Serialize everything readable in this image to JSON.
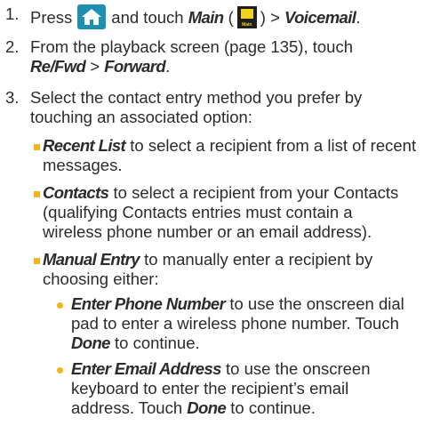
{
  "colors": {
    "text": "#2b2b2b",
    "bullet": "#f2b61c",
    "home_icon_bg": "#1d8fb0",
    "main_icon_bg": "#1e1e1e",
    "main_icon_accent": "#f2d21a"
  },
  "step1": {
    "number": "1.",
    "press": "Press",
    "and_touch": "and touch",
    "main": "Main",
    "paren_open": "(",
    "main_icon_label": "Main",
    "paren_close": ")",
    "sep": " > ",
    "voicemail": "Voicemail",
    "period": "."
  },
  "step2": {
    "number": "2.",
    "line1": "From the playback screen (page 135), touch",
    "re_fwd": "Re/Fwd",
    "sep": " > ",
    "forward": "Forward",
    "period": "."
  },
  "step3": {
    "number": "3.",
    "line1": "Select the contact entry method you prefer by",
    "line2": "touching an associated option:",
    "options": [
      {
        "name": "Recent List",
        "lines": [
          " to select a recipient from a list of recent",
          "messages."
        ]
      },
      {
        "name": "Contacts",
        "lines": [
          " to select a recipient from your Contacts",
          "(qualifying Contacts entries must contain a",
          "wireless phone number or an email address)."
        ]
      },
      {
        "name": "Manual Entry",
        "lines": [
          " to manually enter a recipient by",
          "choosing either:"
        ]
      }
    ],
    "sub_options": [
      {
        "name": "Enter Phone Number",
        "line1": " to use the onscreen dial",
        "line2": "pad to enter a wireless phone number. Touch",
        "done": "Done",
        "tail": " to continue."
      },
      {
        "name": "Enter Email Address",
        "line1": " to use the onscreen",
        "line2": "keyboard to enter the recipient’s email",
        "line3_pre": "address. Touch ",
        "done": "Done",
        "tail": " to continue."
      }
    ]
  },
  "icons": {
    "home": "home-icon",
    "main": "main-menu-icon"
  }
}
